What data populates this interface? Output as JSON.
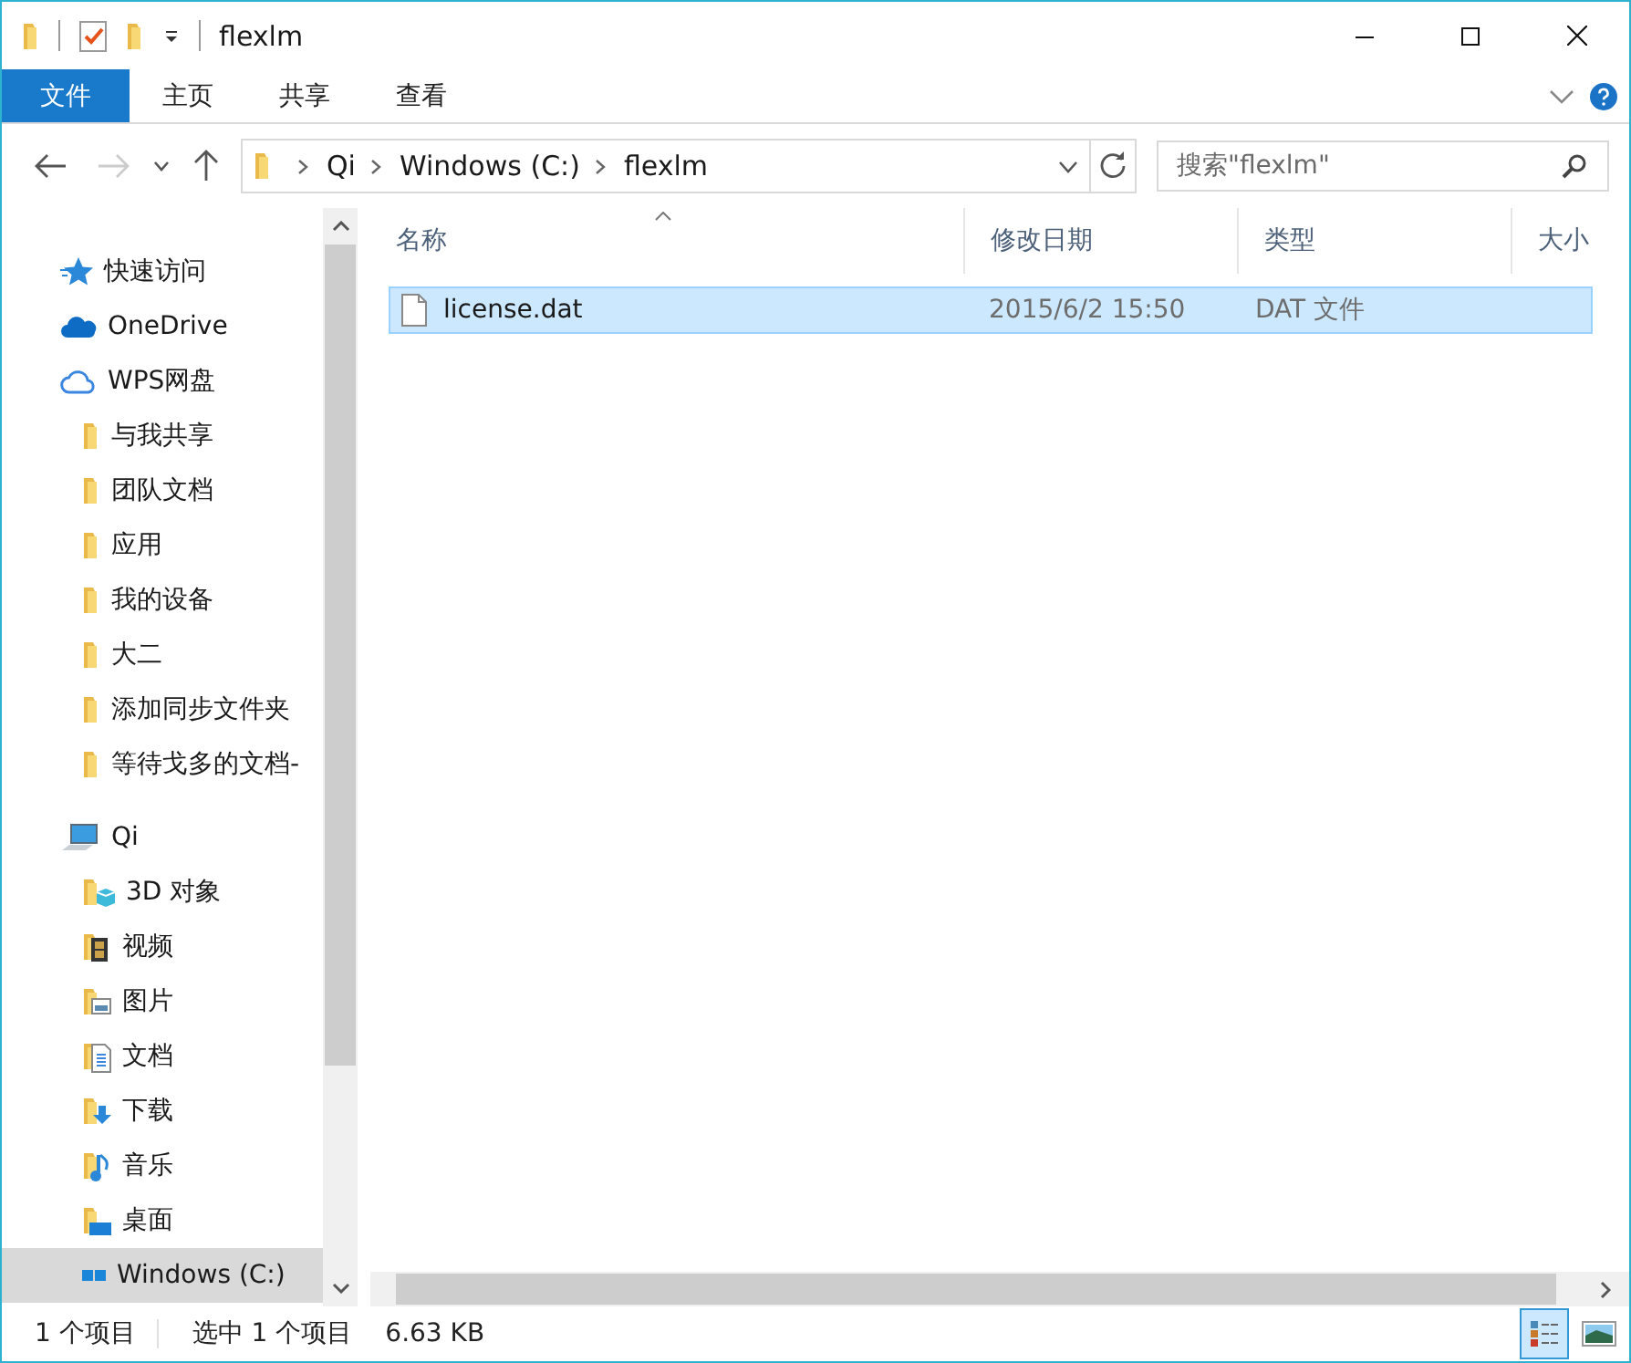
{
  "window": {
    "title": "flexlm"
  },
  "ribbon": {
    "file_tab": "文件",
    "tabs": [
      {
        "label": "主页",
        "selected": false
      },
      {
        "label": "共享",
        "selected": false
      },
      {
        "label": "查看",
        "selected": false
      }
    ]
  },
  "address": {
    "crumbs": [
      "Qi",
      "Windows (C:)",
      "flexlm"
    ],
    "back_disabled": false,
    "forward_disabled": true
  },
  "search": {
    "placeholder": "搜索\"flexlm\""
  },
  "nav": [
    {
      "label": "快速访问",
      "kind": "quick-access",
      "selected": false
    },
    {
      "label": "OneDrive",
      "kind": "onedrive",
      "selected": false
    },
    {
      "label": "WPS网盘",
      "kind": "cloud",
      "selected": false,
      "children": [
        {
          "label": "与我共享",
          "kind": "folder",
          "selected": false
        },
        {
          "label": "团队文档",
          "kind": "folder",
          "selected": false
        },
        {
          "label": "应用",
          "kind": "folder",
          "selected": false
        },
        {
          "label": "我的设备",
          "kind": "folder",
          "selected": false
        },
        {
          "label": "大二",
          "kind": "folder",
          "selected": false
        },
        {
          "label": "添加同步文件夹",
          "kind": "folder",
          "selected": false
        },
        {
          "label": "等待戈多的文档-",
          "kind": "folder",
          "selected": false
        }
      ]
    },
    {
      "label": "Qi",
      "kind": "computer",
      "selected": false,
      "children": [
        {
          "label": "3D 对象",
          "kind": "objects",
          "selected": false
        },
        {
          "label": "视频",
          "kind": "videos",
          "selected": false
        },
        {
          "label": "图片",
          "kind": "pictures",
          "selected": false
        },
        {
          "label": "文档",
          "kind": "documents",
          "selected": false
        },
        {
          "label": "下载",
          "kind": "downloads",
          "selected": false
        },
        {
          "label": "音乐",
          "kind": "music",
          "selected": false
        },
        {
          "label": "桌面",
          "kind": "desktop",
          "selected": false
        },
        {
          "label": "Windows (C:)",
          "kind": "drive",
          "selected": true
        }
      ]
    }
  ],
  "columns": [
    {
      "label": "名称",
      "sorted": true
    },
    {
      "label": "修改日期",
      "sorted": false
    },
    {
      "label": "类型",
      "sorted": false
    },
    {
      "label": "大小",
      "sorted": false
    }
  ],
  "files": [
    {
      "name": "license.dat",
      "modified": "2015/6/2 15:50",
      "type": "DAT 文件",
      "selected": true
    }
  ],
  "status_bar": {
    "count": "1 个项目",
    "selection": "选中 1 个项目",
    "size": "6.63 KB",
    "views": [
      {
        "kind": "details",
        "selected": true
      },
      {
        "kind": "large-icons",
        "selected": false
      }
    ]
  }
}
